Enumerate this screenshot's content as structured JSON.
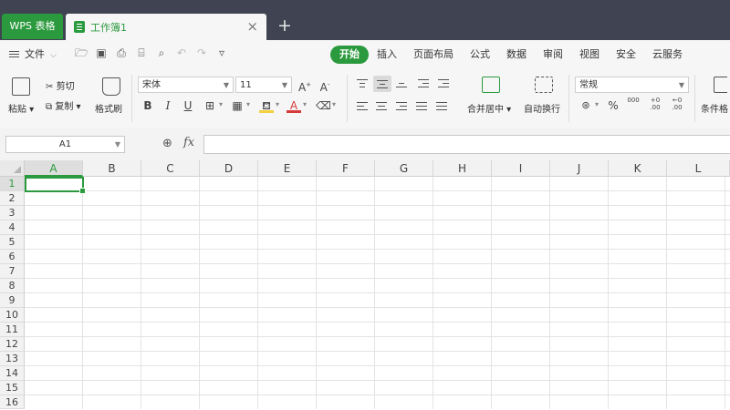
{
  "titlebar": {
    "app_tab": "WPS 表格",
    "doc_tab": "工作簿1",
    "close_glyph": "×",
    "new_tab_glyph": "+"
  },
  "menu": {
    "file_label": "文件",
    "tabs": [
      "开始",
      "插入",
      "页面布局",
      "公式",
      "数据",
      "审阅",
      "视图",
      "安全",
      "云服务"
    ],
    "active_tab": "开始"
  },
  "ribbon": {
    "paste_label": "粘贴",
    "cut_label": "剪切",
    "copy_label": "复制",
    "format_painter_label": "格式刷",
    "font_name": "宋体",
    "font_size": "11",
    "bold": "B",
    "italic": "I",
    "underline": "U",
    "merge_label": "合并居中",
    "wrap_label": "自动换行",
    "number_format": "常规",
    "percent": "%",
    "thousands": "000",
    "inc_decimal": "+0\n.00",
    "dec_decimal": "←0\n.00",
    "conditional_label": "条件格"
  },
  "formula_bar": {
    "name_box": "A1",
    "fx": "fx",
    "value": ""
  },
  "grid": {
    "columns": [
      "A",
      "B",
      "C",
      "D",
      "E",
      "F",
      "G",
      "H",
      "I",
      "J",
      "K",
      "L"
    ],
    "rows": [
      "1",
      "2",
      "3",
      "4",
      "5",
      "6",
      "7",
      "8",
      "9",
      "10",
      "11",
      "12",
      "13",
      "14",
      "15",
      "16"
    ],
    "active_cell": "A1"
  },
  "colors": {
    "accent": "#2b9a3e",
    "titlebar": "#3f4352"
  }
}
